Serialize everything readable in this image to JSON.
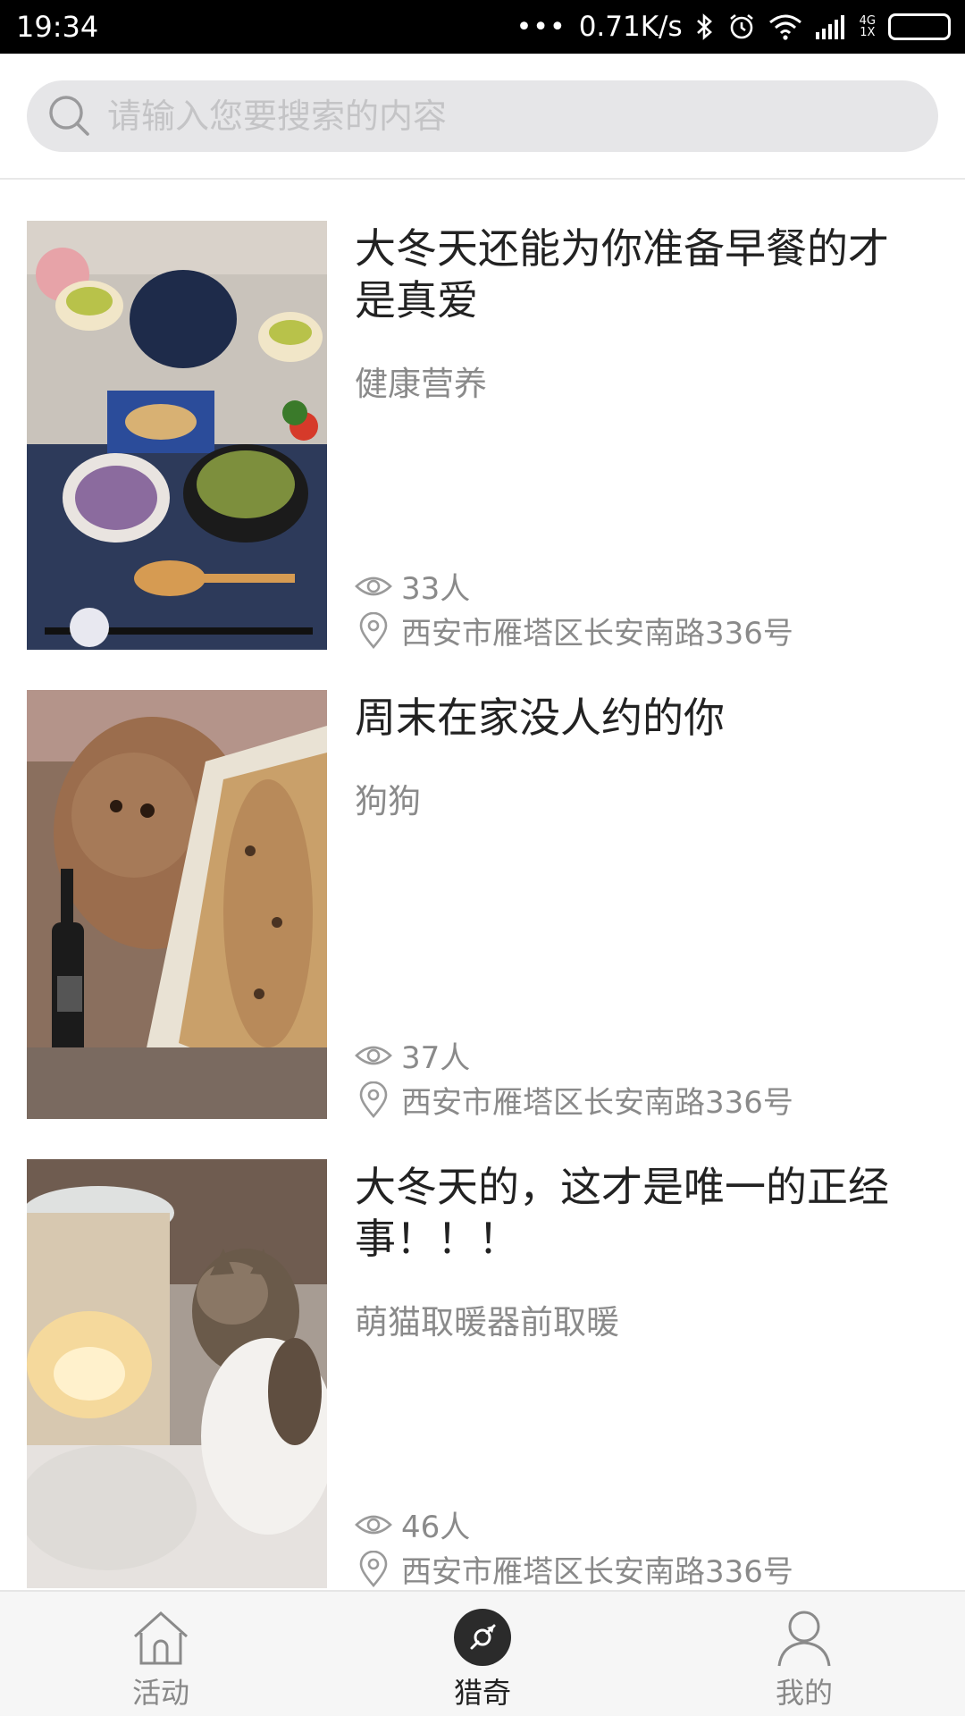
{
  "status_bar": {
    "time": "19:34",
    "network_speed": "0.71K/s",
    "network_type_top": "4G",
    "network_type_bottom": "1X",
    "icons": [
      "more-dots-icon",
      "bluetooth-icon",
      "alarm-icon",
      "wifi-icon",
      "signal-icon",
      "battery-icon"
    ]
  },
  "search": {
    "placeholder": "请输入您要搜索的内容"
  },
  "items": [
    {
      "title": "大冬天还能为你准备早餐的才是真爱",
      "category": "健康营养",
      "views": "33人",
      "address": "西安市雁塔区长安南路336号",
      "image": "breakfast-table-photo"
    },
    {
      "title": "周末在家没人约的你",
      "category": "狗狗",
      "views": "37人",
      "address": "西安市雁塔区长安南路336号",
      "image": "dog-with-pizza-photo"
    },
    {
      "title": "大冬天的，这才是唯一的正经事！！！",
      "category": "萌猫取暖器前取暖",
      "views": "46人",
      "address": "西安市雁塔区长安南路336号",
      "image": "cat-by-heater-photo"
    }
  ],
  "tabs": [
    {
      "label": "活动",
      "icon": "home-icon",
      "active": false
    },
    {
      "label": "猎奇",
      "icon": "compass-icon",
      "active": true
    },
    {
      "label": "我的",
      "icon": "user-icon",
      "active": false
    }
  ],
  "colors": {
    "status_bar_bg": "#000000",
    "search_bg": "#e6e6e8",
    "muted_text": "#8a8a8a",
    "title_text": "#222222",
    "active_tab_icon": "#2b2b2b"
  }
}
